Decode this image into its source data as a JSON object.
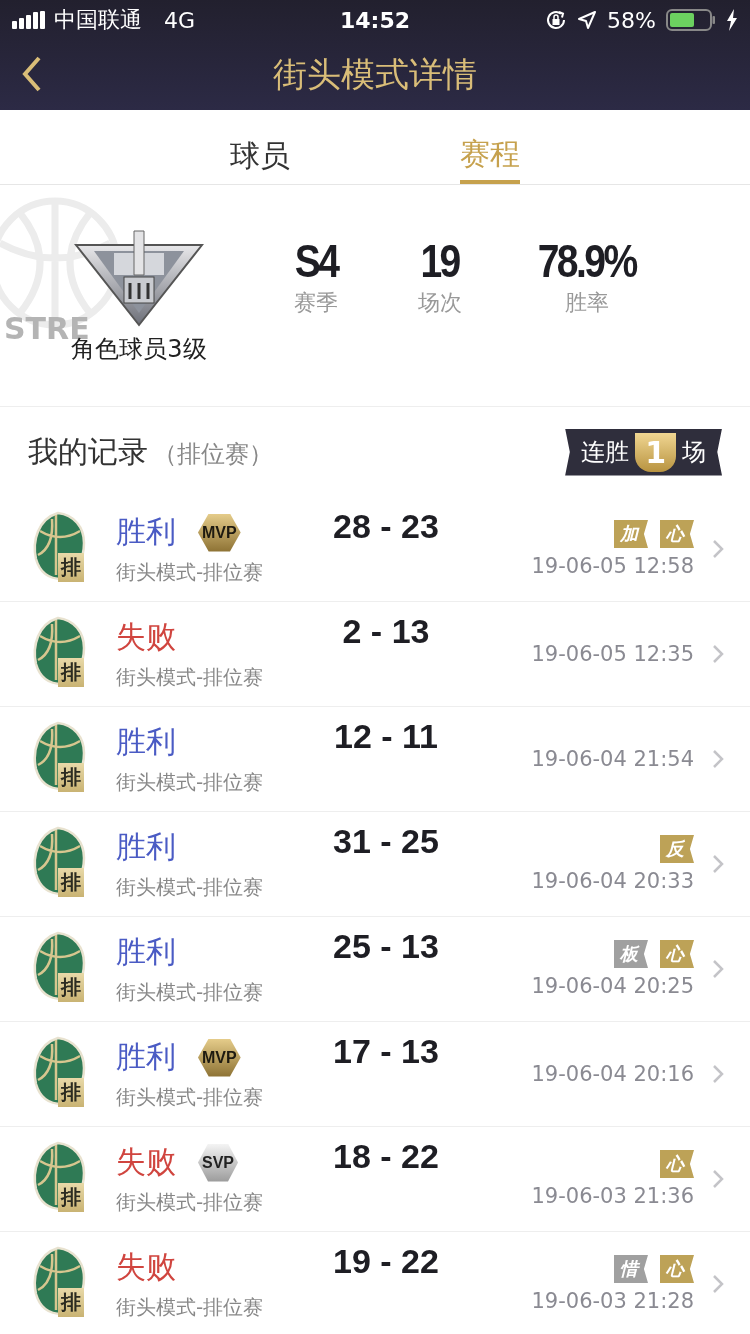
{
  "status_bar": {
    "carrier": "中国联通",
    "network": "4G",
    "time": "14:52",
    "battery": "58%"
  },
  "nav": {
    "title": "街头模式详情"
  },
  "tabs": [
    {
      "label": "球员",
      "selected": false
    },
    {
      "label": "赛程",
      "selected": true
    }
  ],
  "profile": {
    "decor_text": "STRE",
    "rank_name": "角色球员3级",
    "stats": [
      {
        "value": "S4",
        "label": "赛季"
      },
      {
        "value": "19",
        "label": "场次"
      },
      {
        "value": "78.9%",
        "label": "胜率"
      }
    ]
  },
  "records": {
    "title": "我的记录",
    "subtitle": "（排位赛）",
    "streak": {
      "prefix": "连胜",
      "count": "1",
      "suffix": "场"
    }
  },
  "rows": [
    {
      "kind": "win",
      "result": "胜利",
      "badge": {
        "text": "MVP",
        "kind": "gold"
      },
      "rank_label": "排",
      "mode": "街头模式-排位赛",
      "score": "28 - 23",
      "tags": [
        {
          "text": "加",
          "kind": "gold"
        },
        {
          "text": "心",
          "kind": "gold"
        }
      ],
      "time": "19-06-05 12:58"
    },
    {
      "kind": "loss",
      "result": "失败",
      "rank_label": "排",
      "mode": "街头模式-排位赛",
      "score": "2 - 13",
      "tags": [],
      "time": "19-06-05 12:35"
    },
    {
      "kind": "win",
      "result": "胜利",
      "rank_label": "排",
      "mode": "街头模式-排位赛",
      "score": "12 - 11",
      "tags": [],
      "time": "19-06-04 21:54"
    },
    {
      "kind": "win",
      "result": "胜利",
      "rank_label": "排",
      "mode": "街头模式-排位赛",
      "score": "31 - 25",
      "tags": [
        {
          "text": "反",
          "kind": "gold"
        }
      ],
      "time": "19-06-04 20:33"
    },
    {
      "kind": "win",
      "result": "胜利",
      "rank_label": "排",
      "mode": "街头模式-排位赛",
      "score": "25 - 13",
      "tags": [
        {
          "text": "板",
          "kind": "grey"
        },
        {
          "text": "心",
          "kind": "gold"
        }
      ],
      "time": "19-06-04 20:25"
    },
    {
      "kind": "win",
      "result": "胜利",
      "badge": {
        "text": "MVP",
        "kind": "gold"
      },
      "rank_label": "排",
      "mode": "街头模式-排位赛",
      "score": "17 - 13",
      "tags": [],
      "time": "19-06-04 20:16"
    },
    {
      "kind": "loss",
      "result": "失败",
      "badge": {
        "text": "SVP",
        "kind": "silver"
      },
      "rank_label": "排",
      "mode": "街头模式-排位赛",
      "score": "18 - 22",
      "tags": [
        {
          "text": "心",
          "kind": "gold"
        }
      ],
      "time": "19-06-03 21:36"
    },
    {
      "kind": "loss",
      "result": "失败",
      "rank_label": "排",
      "mode": "街头模式-排位赛",
      "score": "19 - 22",
      "tags": [
        {
          "text": "惜",
          "kind": "grey"
        },
        {
          "text": "心",
          "kind": "gold"
        }
      ],
      "time": "19-06-03 21:28"
    }
  ]
}
